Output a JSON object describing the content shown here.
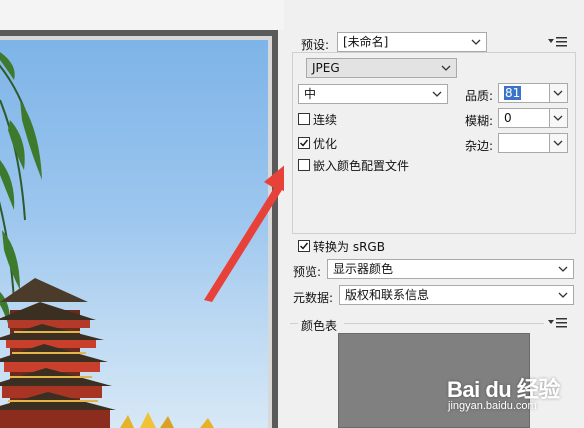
{
  "preset": {
    "label": "预设:",
    "value": "[未命名]"
  },
  "format": {
    "value": "JPEG"
  },
  "quality_level": {
    "value": "中"
  },
  "quality": {
    "label": "品质:",
    "value": "81"
  },
  "blur": {
    "label": "模糊:",
    "value": "0"
  },
  "matte": {
    "label": "杂边:",
    "value": ""
  },
  "progressive": {
    "label": "连续",
    "checked": false
  },
  "optimized": {
    "label": "优化",
    "checked": true
  },
  "embed_profile": {
    "label": "嵌入颜色配置文件",
    "checked": false
  },
  "convert_srgb": {
    "label": "转换为 sRGB",
    "checked": true
  },
  "preview": {
    "label": "预览:",
    "value": "显示器颜色"
  },
  "metadata": {
    "label": "元数据:",
    "value": "版权和联系信息"
  },
  "color_table": {
    "label": "颜色表"
  },
  "watermark": {
    "brand": "Bai du 经验",
    "url": "jingyan.baidu.com"
  },
  "colors": {
    "panel": "#f0f0f0",
    "selection": "#3a74c8",
    "arrow": "#e8413a",
    "swatch": "#808080"
  }
}
